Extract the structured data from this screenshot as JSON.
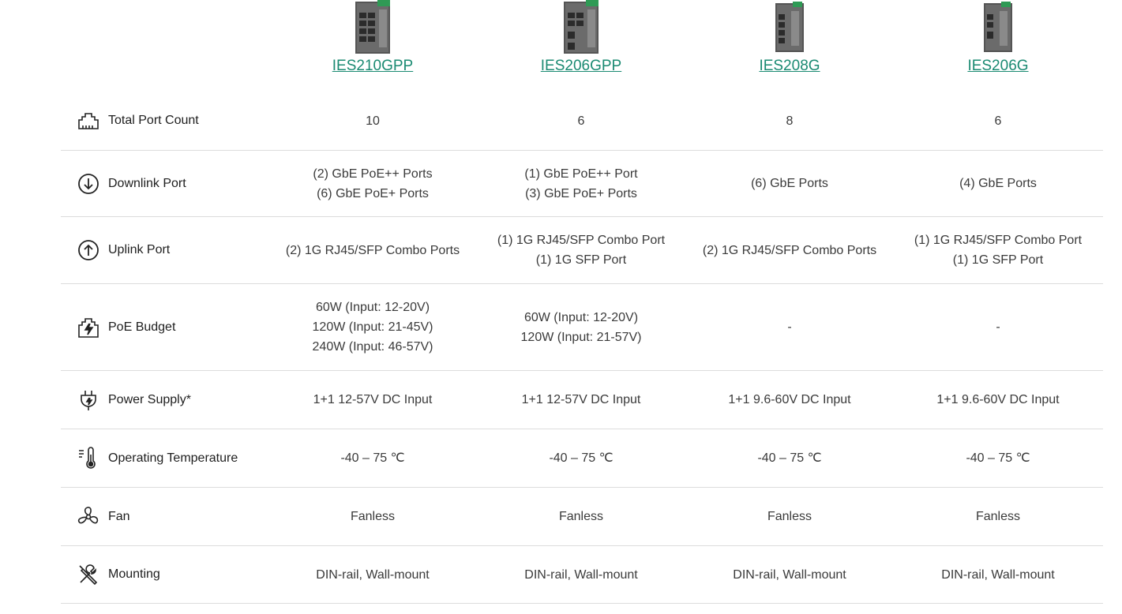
{
  "products": [
    {
      "name": "IES210GPP"
    },
    {
      "name": "IES206GPP"
    },
    {
      "name": "IES208G"
    },
    {
      "name": "IES206G"
    }
  ],
  "rows": [
    {
      "label": "Total Port Count",
      "icon": "ports-icon",
      "values": [
        [
          "10"
        ],
        [
          "6"
        ],
        [
          "8"
        ],
        [
          "6"
        ]
      ]
    },
    {
      "label": "Downlink Port",
      "icon": "downlink-arrow-icon",
      "values": [
        [
          "(2) GbE PoE++ Ports",
          "(6) GbE PoE+ Ports"
        ],
        [
          "(1) GbE PoE++ Port",
          "(3) GbE PoE+ Ports"
        ],
        [
          "(6) GbE Ports"
        ],
        [
          "(4) GbE Ports"
        ]
      ]
    },
    {
      "label": "Uplink Port",
      "icon": "uplink-arrow-icon",
      "values": [
        [
          "(2) 1G RJ45/SFP Combo Ports"
        ],
        [
          "(1) 1G RJ45/SFP Combo Port",
          "(1) 1G SFP Port"
        ],
        [
          "(2) 1G RJ45/SFP Combo Ports"
        ],
        [
          "(1) 1G RJ45/SFP Combo Port",
          "(1) 1G SFP Port"
        ]
      ]
    },
    {
      "label": "PoE Budget",
      "icon": "poe-bolt-icon",
      "values": [
        [
          "60W (Input: 12-20V)",
          "120W (Input: 21-45V)",
          "240W (Input: 46-57V)"
        ],
        [
          "60W (Input: 12-20V)",
          "120W (Input: 21-57V)"
        ],
        [
          "-"
        ],
        [
          "-"
        ]
      ]
    },
    {
      "label": "Power Supply*",
      "icon": "power-plug-icon",
      "values": [
        [
          "1+1 12-57V DC Input"
        ],
        [
          "1+1 12-57V DC Input"
        ],
        [
          "1+1 9.6-60V DC Input"
        ],
        [
          "1+1 9.6-60V DC Input"
        ]
      ]
    },
    {
      "label": "Operating Temperature",
      "icon": "thermometer-icon",
      "values": [
        [
          "-40 – 75 ℃"
        ],
        [
          "-40 – 75 ℃"
        ],
        [
          "-40 – 75 ℃"
        ],
        [
          "-40 – 75 ℃"
        ]
      ]
    },
    {
      "label": "Fan",
      "icon": "fan-icon",
      "values": [
        [
          "Fanless"
        ],
        [
          "Fanless"
        ],
        [
          "Fanless"
        ],
        [
          "Fanless"
        ]
      ]
    },
    {
      "label": "Mounting",
      "icon": "tools-icon",
      "values": [
        [
          "DIN-rail, Wall-mount"
        ],
        [
          "DIN-rail, Wall-mount"
        ],
        [
          "DIN-rail, Wall-mount"
        ],
        [
          "DIN-rail, Wall-mount"
        ]
      ]
    }
  ]
}
